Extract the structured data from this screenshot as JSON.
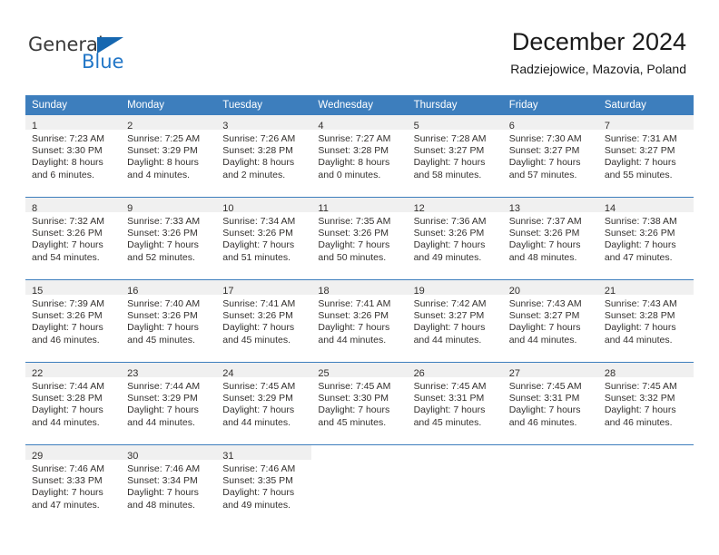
{
  "brand": {
    "name_top": "General",
    "name_bottom": "Blue",
    "triangle_color": "#1667b0",
    "blue_color": "#2176c7"
  },
  "header": {
    "title": "December 2024",
    "subtitle": "Radziejowice, Mazovia, Poland",
    "header_bg": "#3d7ebd",
    "daynum_bg": "#f0f0f0"
  },
  "weekday_headers": [
    "Sunday",
    "Monday",
    "Tuesday",
    "Wednesday",
    "Thursday",
    "Friday",
    "Saturday"
  ],
  "weeks": [
    [
      {
        "day": "1",
        "sunrise": "Sunrise: 7:23 AM",
        "sunset": "Sunset: 3:30 PM",
        "daylight1": "Daylight: 8 hours",
        "daylight2": "and 6 minutes."
      },
      {
        "day": "2",
        "sunrise": "Sunrise: 7:25 AM",
        "sunset": "Sunset: 3:29 PM",
        "daylight1": "Daylight: 8 hours",
        "daylight2": "and 4 minutes."
      },
      {
        "day": "3",
        "sunrise": "Sunrise: 7:26 AM",
        "sunset": "Sunset: 3:28 PM",
        "daylight1": "Daylight: 8 hours",
        "daylight2": "and 2 minutes."
      },
      {
        "day": "4",
        "sunrise": "Sunrise: 7:27 AM",
        "sunset": "Sunset: 3:28 PM",
        "daylight1": "Daylight: 8 hours",
        "daylight2": "and 0 minutes."
      },
      {
        "day": "5",
        "sunrise": "Sunrise: 7:28 AM",
        "sunset": "Sunset: 3:27 PM",
        "daylight1": "Daylight: 7 hours",
        "daylight2": "and 58 minutes."
      },
      {
        "day": "6",
        "sunrise": "Sunrise: 7:30 AM",
        "sunset": "Sunset: 3:27 PM",
        "daylight1": "Daylight: 7 hours",
        "daylight2": "and 57 minutes."
      },
      {
        "day": "7",
        "sunrise": "Sunrise: 7:31 AM",
        "sunset": "Sunset: 3:27 PM",
        "daylight1": "Daylight: 7 hours",
        "daylight2": "and 55 minutes."
      }
    ],
    [
      {
        "day": "8",
        "sunrise": "Sunrise: 7:32 AM",
        "sunset": "Sunset: 3:26 PM",
        "daylight1": "Daylight: 7 hours",
        "daylight2": "and 54 minutes."
      },
      {
        "day": "9",
        "sunrise": "Sunrise: 7:33 AM",
        "sunset": "Sunset: 3:26 PM",
        "daylight1": "Daylight: 7 hours",
        "daylight2": "and 52 minutes."
      },
      {
        "day": "10",
        "sunrise": "Sunrise: 7:34 AM",
        "sunset": "Sunset: 3:26 PM",
        "daylight1": "Daylight: 7 hours",
        "daylight2": "and 51 minutes."
      },
      {
        "day": "11",
        "sunrise": "Sunrise: 7:35 AM",
        "sunset": "Sunset: 3:26 PM",
        "daylight1": "Daylight: 7 hours",
        "daylight2": "and 50 minutes."
      },
      {
        "day": "12",
        "sunrise": "Sunrise: 7:36 AM",
        "sunset": "Sunset: 3:26 PM",
        "daylight1": "Daylight: 7 hours",
        "daylight2": "and 49 minutes."
      },
      {
        "day": "13",
        "sunrise": "Sunrise: 7:37 AM",
        "sunset": "Sunset: 3:26 PM",
        "daylight1": "Daylight: 7 hours",
        "daylight2": "and 48 minutes."
      },
      {
        "day": "14",
        "sunrise": "Sunrise: 7:38 AM",
        "sunset": "Sunset: 3:26 PM",
        "daylight1": "Daylight: 7 hours",
        "daylight2": "and 47 minutes."
      }
    ],
    [
      {
        "day": "15",
        "sunrise": "Sunrise: 7:39 AM",
        "sunset": "Sunset: 3:26 PM",
        "daylight1": "Daylight: 7 hours",
        "daylight2": "and 46 minutes."
      },
      {
        "day": "16",
        "sunrise": "Sunrise: 7:40 AM",
        "sunset": "Sunset: 3:26 PM",
        "daylight1": "Daylight: 7 hours",
        "daylight2": "and 45 minutes."
      },
      {
        "day": "17",
        "sunrise": "Sunrise: 7:41 AM",
        "sunset": "Sunset: 3:26 PM",
        "daylight1": "Daylight: 7 hours",
        "daylight2": "and 45 minutes."
      },
      {
        "day": "18",
        "sunrise": "Sunrise: 7:41 AM",
        "sunset": "Sunset: 3:26 PM",
        "daylight1": "Daylight: 7 hours",
        "daylight2": "and 44 minutes."
      },
      {
        "day": "19",
        "sunrise": "Sunrise: 7:42 AM",
        "sunset": "Sunset: 3:27 PM",
        "daylight1": "Daylight: 7 hours",
        "daylight2": "and 44 minutes."
      },
      {
        "day": "20",
        "sunrise": "Sunrise: 7:43 AM",
        "sunset": "Sunset: 3:27 PM",
        "daylight1": "Daylight: 7 hours",
        "daylight2": "and 44 minutes."
      },
      {
        "day": "21",
        "sunrise": "Sunrise: 7:43 AM",
        "sunset": "Sunset: 3:28 PM",
        "daylight1": "Daylight: 7 hours",
        "daylight2": "and 44 minutes."
      }
    ],
    [
      {
        "day": "22",
        "sunrise": "Sunrise: 7:44 AM",
        "sunset": "Sunset: 3:28 PM",
        "daylight1": "Daylight: 7 hours",
        "daylight2": "and 44 minutes."
      },
      {
        "day": "23",
        "sunrise": "Sunrise: 7:44 AM",
        "sunset": "Sunset: 3:29 PM",
        "daylight1": "Daylight: 7 hours",
        "daylight2": "and 44 minutes."
      },
      {
        "day": "24",
        "sunrise": "Sunrise: 7:45 AM",
        "sunset": "Sunset: 3:29 PM",
        "daylight1": "Daylight: 7 hours",
        "daylight2": "and 44 minutes."
      },
      {
        "day": "25",
        "sunrise": "Sunrise: 7:45 AM",
        "sunset": "Sunset: 3:30 PM",
        "daylight1": "Daylight: 7 hours",
        "daylight2": "and 45 minutes."
      },
      {
        "day": "26",
        "sunrise": "Sunrise: 7:45 AM",
        "sunset": "Sunset: 3:31 PM",
        "daylight1": "Daylight: 7 hours",
        "daylight2": "and 45 minutes."
      },
      {
        "day": "27",
        "sunrise": "Sunrise: 7:45 AM",
        "sunset": "Sunset: 3:31 PM",
        "daylight1": "Daylight: 7 hours",
        "daylight2": "and 46 minutes."
      },
      {
        "day": "28",
        "sunrise": "Sunrise: 7:45 AM",
        "sunset": "Sunset: 3:32 PM",
        "daylight1": "Daylight: 7 hours",
        "daylight2": "and 46 minutes."
      }
    ],
    [
      {
        "day": "29",
        "sunrise": "Sunrise: 7:46 AM",
        "sunset": "Sunset: 3:33 PM",
        "daylight1": "Daylight: 7 hours",
        "daylight2": "and 47 minutes."
      },
      {
        "day": "30",
        "sunrise": "Sunrise: 7:46 AM",
        "sunset": "Sunset: 3:34 PM",
        "daylight1": "Daylight: 7 hours",
        "daylight2": "and 48 minutes."
      },
      {
        "day": "31",
        "sunrise": "Sunrise: 7:46 AM",
        "sunset": "Sunset: 3:35 PM",
        "daylight1": "Daylight: 7 hours",
        "daylight2": "and 49 minutes."
      },
      {
        "day": "",
        "sunrise": "",
        "sunset": "",
        "daylight1": "",
        "daylight2": ""
      },
      {
        "day": "",
        "sunrise": "",
        "sunset": "",
        "daylight1": "",
        "daylight2": ""
      },
      {
        "day": "",
        "sunrise": "",
        "sunset": "",
        "daylight1": "",
        "daylight2": ""
      },
      {
        "day": "",
        "sunrise": "",
        "sunset": "",
        "daylight1": "",
        "daylight2": ""
      }
    ]
  ]
}
